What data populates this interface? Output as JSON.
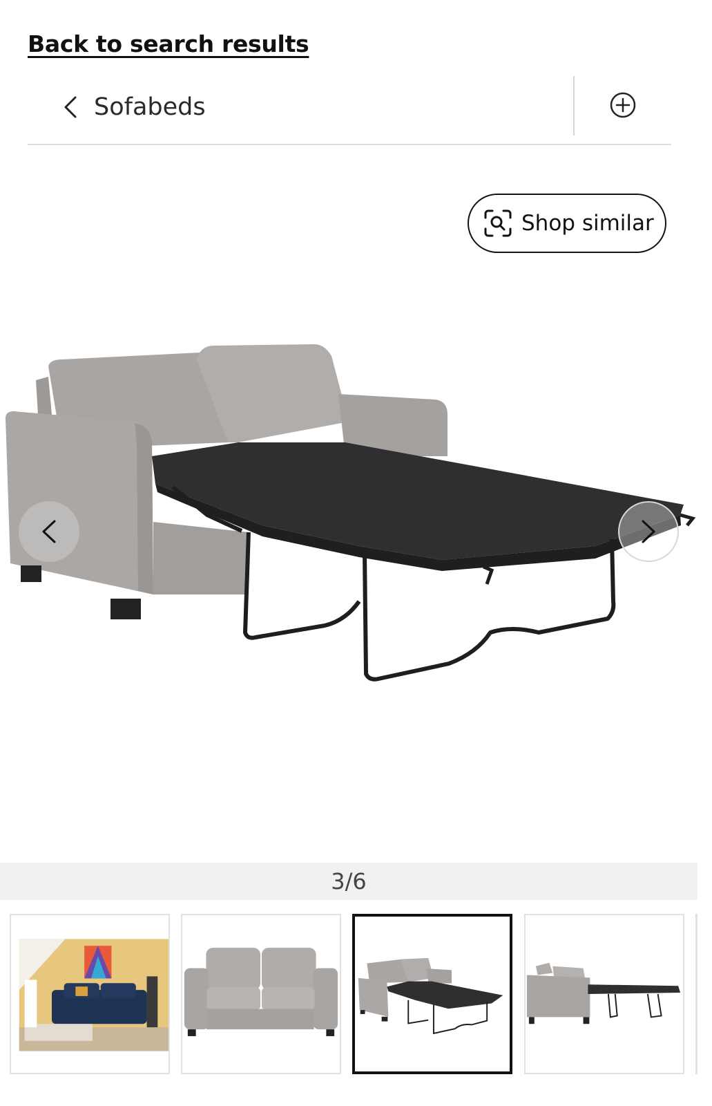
{
  "header": {
    "back_link": "Back to search results",
    "breadcrumb_label": "Sofabeds"
  },
  "gallery": {
    "shop_similar_label": "Shop similar",
    "counter": "3/6",
    "current_index": 3,
    "total_images": 6
  },
  "icons": {
    "breadcrumb_back": "chevron-left-icon",
    "add": "plus-circle-icon",
    "shop_similar": "visual-search-icon",
    "prev": "chevron-left-icon",
    "next": "chevron-right-icon"
  },
  "colors": {
    "sofa_fabric": "#a8a4a1",
    "mattress": "#2f2e30",
    "frame": "#1e1e1e",
    "counter_bg": "#f1f1f1",
    "active_border": "#111111"
  }
}
